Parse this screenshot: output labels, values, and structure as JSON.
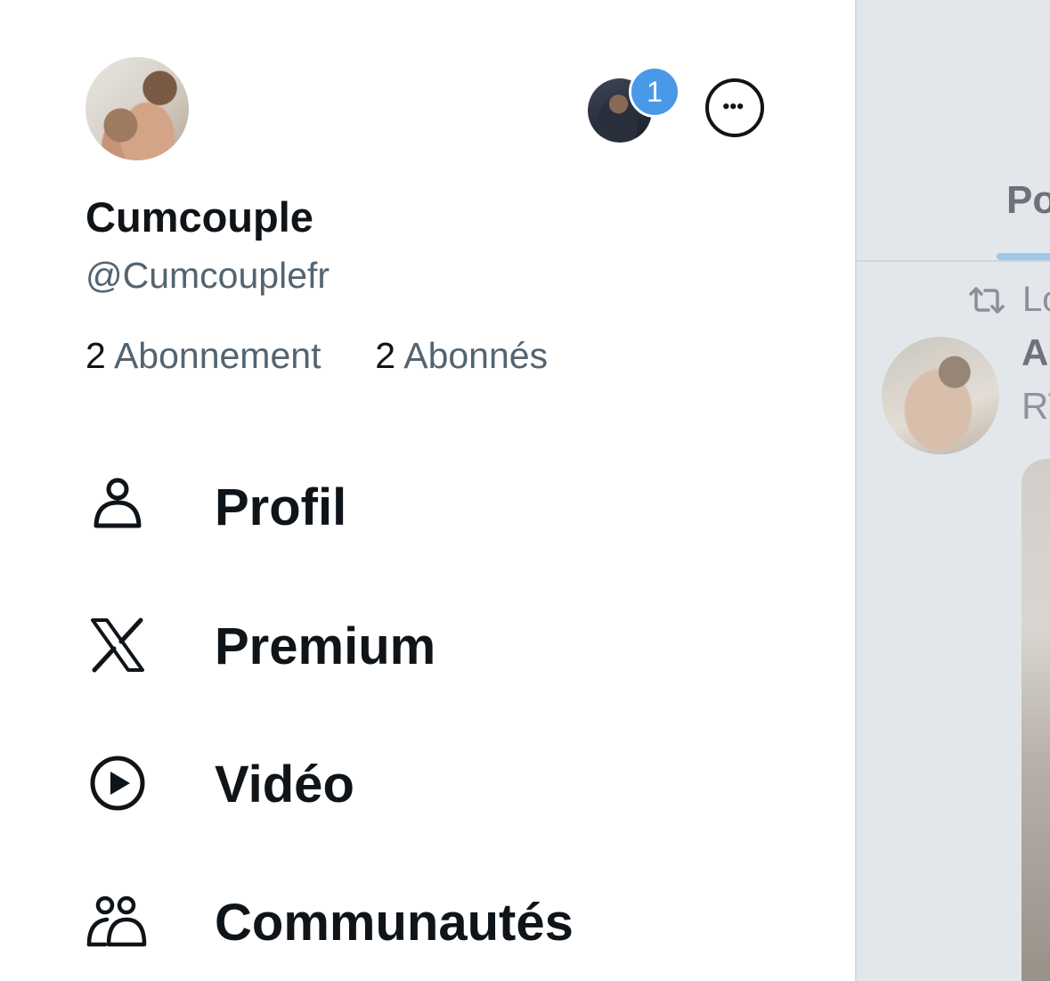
{
  "profile": {
    "display_name": "Cumcouple",
    "handle": "@Cumcouplefr",
    "following_count": "2",
    "following_label": "Abonnement",
    "followers_count": "2",
    "followers_label": "Abonnés"
  },
  "account_switcher": {
    "badge_count": "1"
  },
  "menu": [
    {
      "label": "Profil",
      "icon": "person-icon"
    },
    {
      "label": "Premium",
      "icon": "x-logo-icon"
    },
    {
      "label": "Vidéo",
      "icon": "play-circle-icon"
    },
    {
      "label": "Communautés",
      "icon": "communities-icon"
    }
  ],
  "timeline": {
    "tab_label": "Po",
    "retweet_text": "Lo",
    "author_initial": "A",
    "subtext": "RT"
  },
  "colors": {
    "accent": "#1d9bf0",
    "badge": "#4a99e9",
    "text_primary": "#0f1419",
    "text_secondary": "#536471",
    "overlay": "#e2e7eb"
  }
}
